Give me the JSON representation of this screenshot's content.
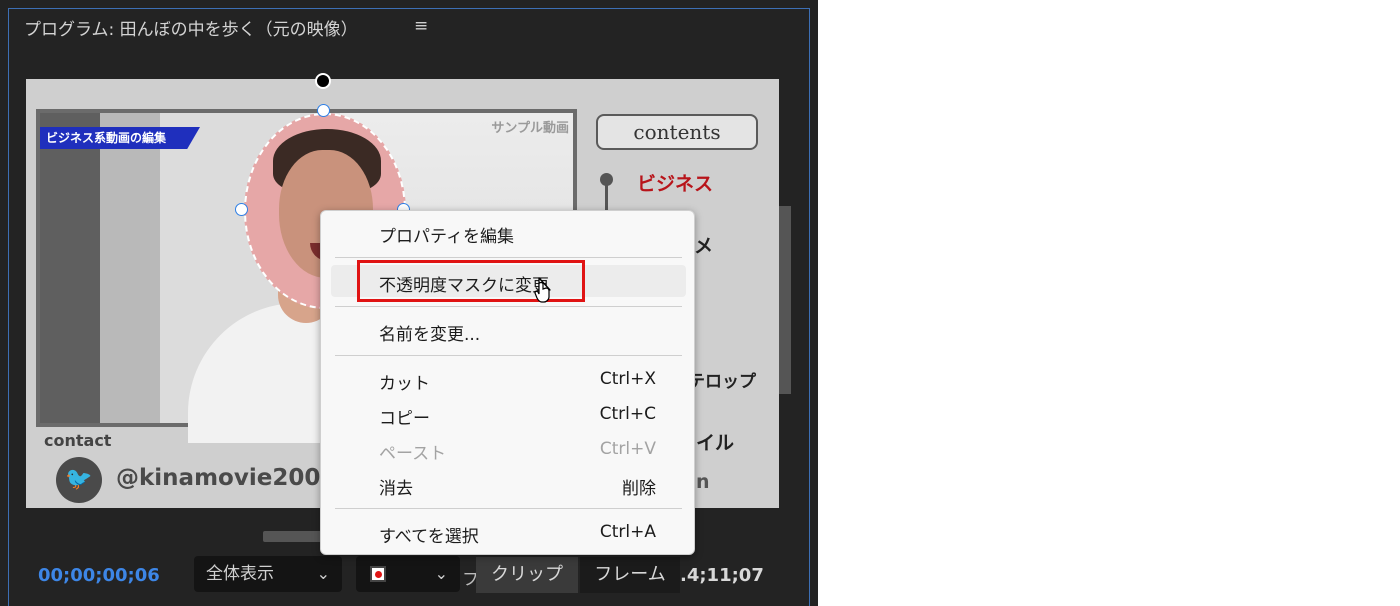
{
  "panel": {
    "title": "プログラム: 田んぼの中を歩く（元の映像）",
    "menu_icon": "≡"
  },
  "video": {
    "tag": "ビジネス系動画の編集",
    "sample_label": "サンプル動画",
    "contact_label": "contact",
    "twitter_icon_glyph": "🐦",
    "twitter_handle": "@kinamovie2000",
    "contents_label": "contents",
    "toc": {
      "item1": "ビジネス",
      "item2_partial": "メ",
      "item3_partial": "テロップ",
      "item4_partial": "イル",
      "item5_partial": "n"
    }
  },
  "controls": {
    "timecode": "00;00;00;06",
    "fit_select": "全体表示",
    "fit_chevron": "⌄",
    "partial_text": "フ",
    "tab_clip": "クリップ",
    "tab_frame": "フレーム",
    "end_time": ".4;11;07"
  },
  "context_menu": {
    "items": [
      {
        "label": "プロパティを編集",
        "shortcut": ""
      },
      {
        "label": "不透明度マスクに変更",
        "shortcut": ""
      },
      {
        "label": "名前を変更...",
        "shortcut": ""
      },
      {
        "label": "カット",
        "shortcut": "Ctrl+X"
      },
      {
        "label": "コピー",
        "shortcut": "Ctrl+C"
      },
      {
        "label": "ペースト",
        "shortcut": "Ctrl+V"
      },
      {
        "label": "消去",
        "shortcut": "削除"
      },
      {
        "label": "すべてを選択",
        "shortcut": "Ctrl+A"
      }
    ]
  },
  "colors": {
    "accent_blue": "#3d86e6",
    "highlight_red": "#e01313",
    "toc_red": "#b8141a"
  }
}
